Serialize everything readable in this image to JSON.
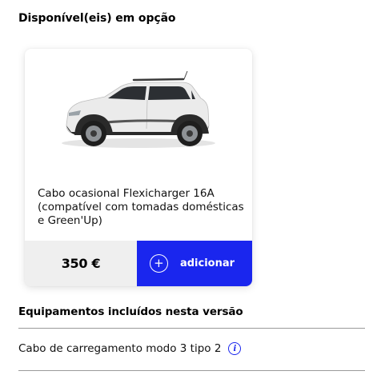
{
  "options_section": {
    "title": "Disponível(eis) em opção"
  },
  "option_card": {
    "image_alt": "car-image",
    "description": "Cabo ocasional Flexicharger 16A (compatível com tomadas domésticas e Green'Up)",
    "price": "350 €",
    "add_label": "adicionar",
    "add_icon": "plus-circle-icon"
  },
  "included_section": {
    "title": "Equipamentos incluídos nesta versão",
    "items": [
      {
        "label": "Cabo de carregamento modo 3 tipo 2",
        "icon": "info-icon"
      }
    ]
  },
  "colors": {
    "accent": "#1a26ee",
    "price_bg": "#efefef",
    "divider": "#9a9a9a"
  }
}
